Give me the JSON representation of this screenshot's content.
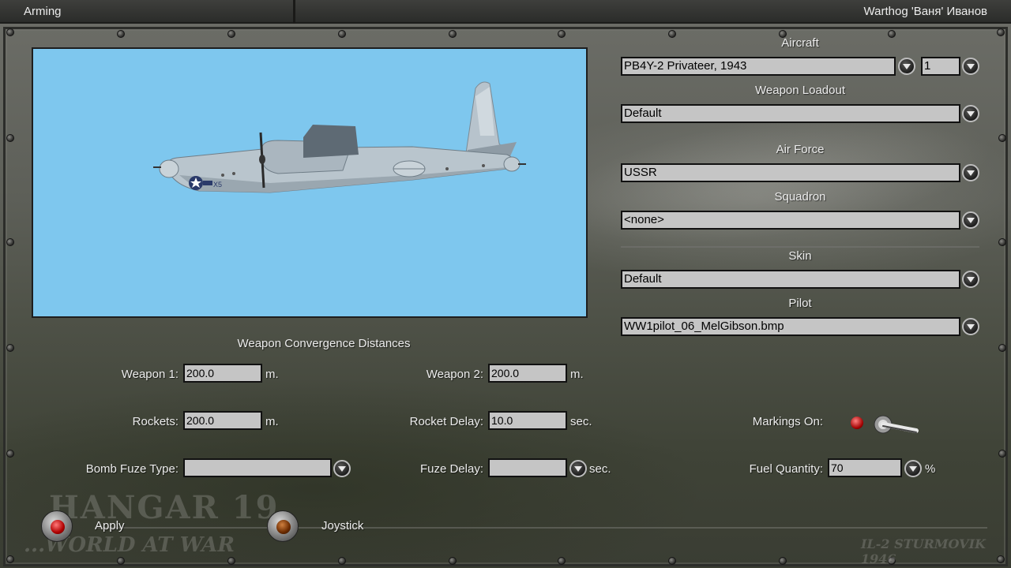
{
  "titlebar": {
    "section": "Arming",
    "user": "Warthog 'Ваня' Иванов"
  },
  "right_panel": {
    "aircraft_label": "Aircraft",
    "aircraft_value": "PB4Y-2 Privateer, 1943",
    "aircraft_count": "1",
    "loadout_label": "Weapon Loadout",
    "loadout_value": "Default",
    "air_force_label": "Air Force",
    "air_force_value": "USSR",
    "squadron_label": "Squadron",
    "squadron_value": "<none>",
    "skin_label": "Skin",
    "skin_value": "Default",
    "pilot_label": "Pilot",
    "pilot_value": "WW1pilot_06_MelGibson.bmp"
  },
  "convergence": {
    "heading": "Weapon Convergence Distances",
    "weapon1_label": "Weapon 1:",
    "weapon1_value": "200.0",
    "weapon1_unit": "m.",
    "weapon2_label": "Weapon 2:",
    "weapon2_value": "200.0",
    "weapon2_unit": "m.",
    "rockets_label": "Rockets:",
    "rockets_value": "200.0",
    "rockets_unit": "m.",
    "rocket_delay_label": "Rocket Delay:",
    "rocket_delay_value": "10.0",
    "rocket_delay_unit": "sec.",
    "bomb_fuze_label": "Bomb Fuze Type:",
    "bomb_fuze_value": "",
    "fuze_delay_label": "Fuze Delay:",
    "fuze_delay_value": "",
    "fuze_delay_unit": "sec.",
    "markings_label": "Markings On:",
    "fuel_label": "Fuel Quantity:",
    "fuel_value": "70",
    "fuel_unit": "%"
  },
  "buttons": {
    "apply": "Apply",
    "joystick": "Joystick"
  },
  "preview": {
    "insignia_code": "X5"
  },
  "watermarks": {
    "logo_top": "HANGAR 19",
    "logo_bottom": "...WORLD AT WAR",
    "game": "IL-2 STURMOVIK 1946"
  },
  "colors": {
    "sky": "#7ec7ee",
    "field_bg": "#c5c5c5",
    "apply_lamp": "#d00000",
    "joystick_lamp": "#7a3200"
  }
}
